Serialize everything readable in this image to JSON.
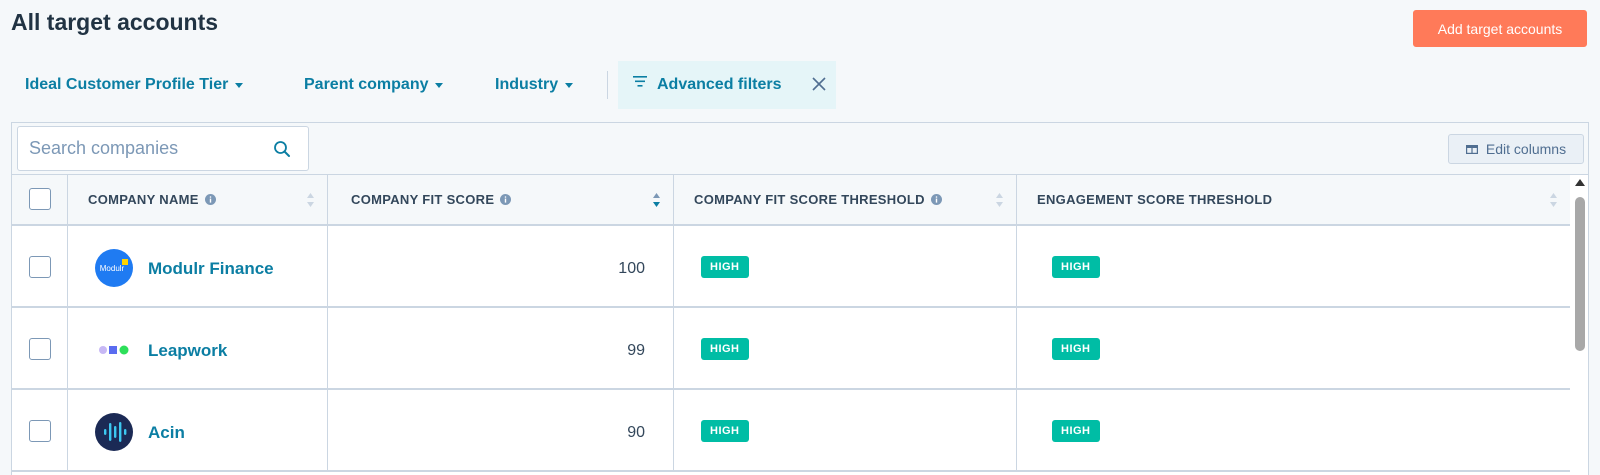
{
  "page": {
    "title": "All target accounts",
    "primary_action": "Add target accounts"
  },
  "filters": [
    {
      "label": "Ideal Customer Profile Tier"
    },
    {
      "label": "Parent company"
    },
    {
      "label": "Industry"
    }
  ],
  "advanced_filters": {
    "label": "Advanced filters"
  },
  "toolbar": {
    "search_placeholder": "Search companies",
    "search_value": "",
    "edit_columns": "Edit columns"
  },
  "table": {
    "columns": [
      {
        "label": "COMPANY NAME",
        "has_info": true
      },
      {
        "label": "COMPANY FIT SCORE",
        "has_info": true,
        "sorted": "descending"
      },
      {
        "label": "COMPANY FIT SCORE THRESHOLD",
        "has_info": true
      },
      {
        "label": "ENGAGEMENT SCORE THRESHOLD",
        "has_info": false
      }
    ],
    "rows": [
      {
        "company": "Modulr Finance",
        "logo_text": "Modulr",
        "fit_score": "100",
        "fit_threshold": "HIGH",
        "engagement_threshold": "HIGH"
      },
      {
        "company": "Leapwork",
        "fit_score": "99",
        "fit_threshold": "HIGH",
        "engagement_threshold": "HIGH"
      },
      {
        "company": "Acin",
        "fit_score": "90",
        "fit_threshold": "HIGH",
        "engagement_threshold": "HIGH"
      }
    ]
  },
  "colors": {
    "accent": "#ff7a59",
    "link": "#0b7ea3",
    "tag": "#00bda5",
    "border": "#cbd6e2"
  },
  "icons": [
    "caret-down-icon",
    "filter-lines-icon",
    "close-icon",
    "search-icon",
    "columns-icon",
    "info-icon",
    "sort-icon"
  ]
}
